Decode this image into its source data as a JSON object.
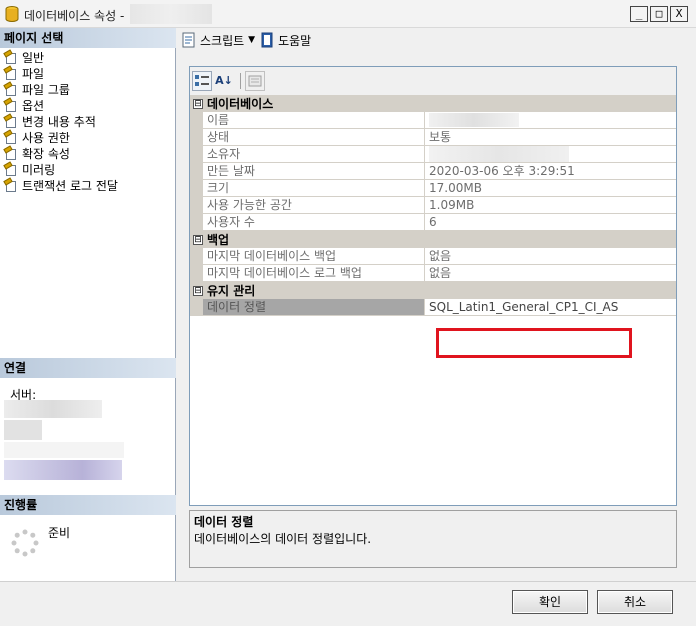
{
  "window": {
    "title": "데이터베이스 속성 -",
    "min": "_",
    "max": "□",
    "close": "X"
  },
  "left": {
    "page_select_header": "페이지 선택",
    "pages": [
      "일반",
      "파일",
      "파일 그룹",
      "옵션",
      "변경 내용 추적",
      "사용 권한",
      "확장 속성",
      "미러링",
      "트랜잭션 로그 전달"
    ],
    "connection_header": "연결",
    "server_label": "서버:",
    "progress_header": "진행률",
    "progress_status": "준비"
  },
  "toolbar": {
    "script_label": "스크립트",
    "script_arrow": "▼",
    "help_label": "도움말"
  },
  "grid": {
    "sort_label": "A↓",
    "categories": [
      {
        "name": "데이터베이스",
        "toggle": "⊟",
        "props": [
          {
            "name": "이름",
            "value": ""
          },
          {
            "name": "상태",
            "value": "보통"
          },
          {
            "name": "소유자",
            "value": ""
          },
          {
            "name": "만든 날짜",
            "value": "2020-03-06 오후 3:29:51"
          },
          {
            "name": "크기",
            "value": "17.00MB"
          },
          {
            "name": "사용 가능한 공간",
            "value": "1.09MB"
          },
          {
            "name": "사용자 수",
            "value": "6"
          }
        ]
      },
      {
        "name": "백업",
        "toggle": "⊟",
        "props": [
          {
            "name": "마지막 데이터베이스 백업",
            "value": "없음"
          },
          {
            "name": "마지막 데이터베이스 로그 백업",
            "value": "없음"
          }
        ]
      },
      {
        "name": "유지 관리",
        "toggle": "⊟",
        "props": [
          {
            "name": "데이터 정렬",
            "value": "SQL_Latin1_General_CP1_CI_AS"
          }
        ]
      }
    ]
  },
  "description": {
    "title": "데이터 정렬",
    "text": "데이터베이스의 데이터 정렬입니다."
  },
  "buttons": {
    "ok": "확인",
    "cancel": "취소"
  },
  "colors": {
    "highlight": "#e0141e",
    "section_header": "#b9c9db"
  }
}
